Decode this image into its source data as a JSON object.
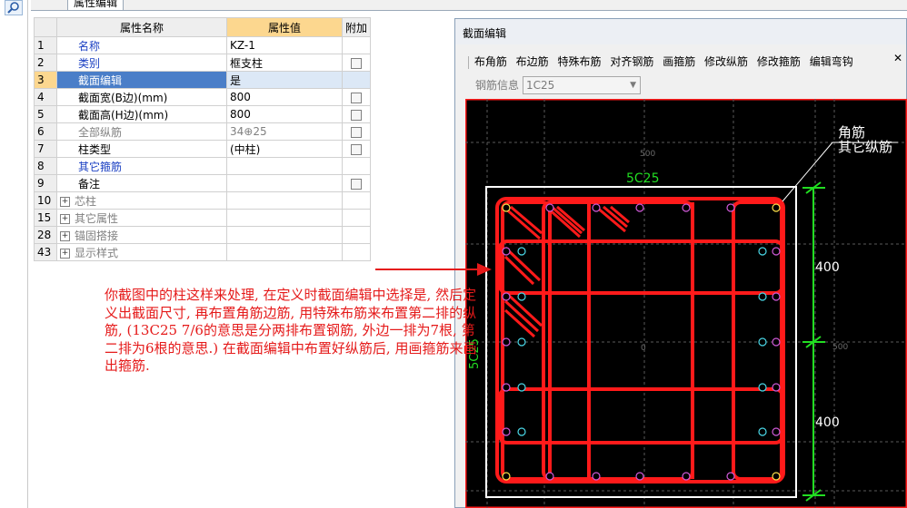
{
  "tab": {
    "label": "属性编辑"
  },
  "table": {
    "headers": {
      "name": "属性名称",
      "value": "属性值",
      "extra": "附加"
    },
    "rows": [
      {
        "num": "1",
        "name": "名称",
        "value": "KZ-1",
        "style": "blue",
        "checkbox": false
      },
      {
        "num": "2",
        "name": "类别",
        "value": "框支柱",
        "style": "blue",
        "checkbox": true
      },
      {
        "num": "3",
        "name": "截面编辑",
        "value": "是",
        "style": "selected",
        "checkbox": false
      },
      {
        "num": "4",
        "name": "截面宽(B边)(mm)",
        "value": "800",
        "style": "normal",
        "checkbox": true
      },
      {
        "num": "5",
        "name": "截面高(H边)(mm)",
        "value": "800",
        "style": "normal",
        "checkbox": true
      },
      {
        "num": "6",
        "name": "全部纵筋",
        "value": "34⊕25",
        "style": "gray",
        "checkbox": true
      },
      {
        "num": "7",
        "name": "柱类型",
        "value": "(中柱)",
        "style": "normal",
        "checkbox": true
      },
      {
        "num": "8",
        "name": "其它箍筋",
        "value": "",
        "style": "blue",
        "checkbox": false
      },
      {
        "num": "9",
        "name": "备注",
        "value": "",
        "style": "normal",
        "checkbox": true
      },
      {
        "num": "10",
        "name": "芯柱",
        "value": "",
        "style": "group",
        "checkbox": false
      },
      {
        "num": "15",
        "name": "其它属性",
        "value": "",
        "style": "group",
        "checkbox": false
      },
      {
        "num": "28",
        "name": "锚固搭接",
        "value": "",
        "style": "group",
        "checkbox": false
      },
      {
        "num": "43",
        "name": "显示样式",
        "value": "",
        "style": "group",
        "checkbox": false
      }
    ]
  },
  "dialog": {
    "title": "截面编辑",
    "toolbar": [
      "布角筋",
      "布边筋",
      "特殊布筋",
      "对齐钢筋",
      "画箍筋",
      "修改纵筋",
      "修改箍筋",
      "编辑弯钩"
    ],
    "rebar_info_label": "钢筋信息",
    "rebar_info_value": "1C25"
  },
  "canvas": {
    "callout_line1": "角筋",
    "callout_line2": "其它纵筋",
    "top_rebar_label": "5C25",
    "side_rebar_label": "5C25",
    "dim_upper": "400",
    "dim_lower": "400",
    "axis_label_top": "500",
    "axis_label_right": "500",
    "center_label": "0"
  },
  "note": "你截图中的柱这样来处理, 在定义时截面编辑中选择是, 然后定义出截面尺寸, 再布置角筋边筋, 用特殊布筋来布置第二排的纵筋, (13C25 7/6的意思是分两排布置钢筋, 外边一排为7根, 第二排为6根的意思.) 在截面编辑中布置好纵筋后, 用画箍筋来画出箍筋.",
  "colors": {
    "rebar": "#ff1a1a",
    "dimension": "#22dd22",
    "canvas_bg": "#000000",
    "note_text": "#e51a1a",
    "header_value_bg": "#fcd78f",
    "selection": "#4a7ec8"
  }
}
